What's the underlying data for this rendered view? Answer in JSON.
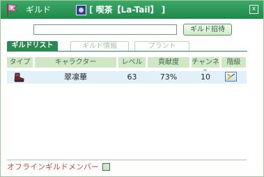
{
  "window": {
    "title": "ギルド",
    "guild_name": "[ 喫茶【La-Tail】 ]",
    "close_label": "x"
  },
  "search": {
    "value": "",
    "placeholder": ""
  },
  "invite_button": "ギルド招待",
  "tabs": [
    {
      "label": "ギルドリスト",
      "active": true
    },
    {
      "label": "ギルド情報",
      "active": false
    },
    {
      "label": "プラント",
      "active": false
    }
  ],
  "columns": [
    "タイプ",
    "キャラクター",
    "レベル",
    "貢献度",
    "チャンネル",
    "階級"
  ],
  "members": [
    {
      "type_icon": "boot-icon",
      "name": "翠凛華",
      "level": "63",
      "contribution": "73%",
      "channel": "10",
      "rank_icon": "guild-master-icon"
    }
  ],
  "footer": {
    "offline_label": "オフラインギルドメンバー",
    "offline_checked": false
  },
  "colors": {
    "titlebar": "#2a9858",
    "tab_active": "#2a8950",
    "header_bg": "#cfe7c5",
    "row_bg": "#e2f0fa",
    "offline_text": "#c74a2e"
  }
}
